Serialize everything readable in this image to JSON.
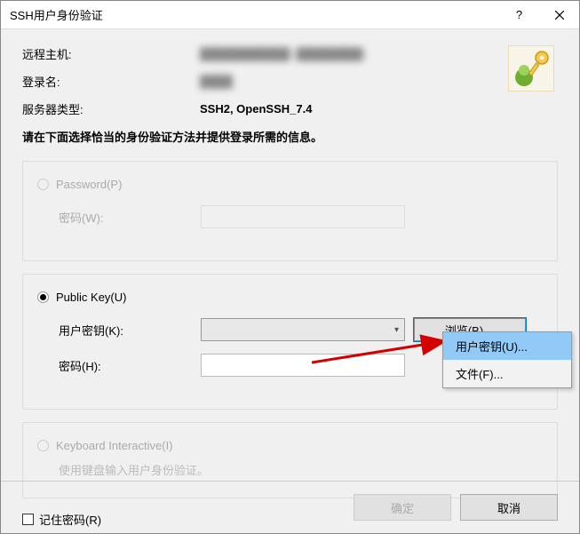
{
  "titlebar": {
    "title": "SSH用户身份验证"
  },
  "info": {
    "host_label": "远程主机:",
    "host_value": "███████████ (████████)",
    "login_label": "登录名:",
    "login_value": "████",
    "server_type_label": "服务器类型:",
    "server_type_value": "SSH2, OpenSSH_7.4"
  },
  "instruction": "请在下面选择恰当的身份验证方法并提供登录所需的信息。",
  "password_group": {
    "radio_label": "Password(P)",
    "pw_label": "密码(W):"
  },
  "pubkey_group": {
    "radio_label": "Public Key(U)",
    "key_label": "用户密钥(K):",
    "pw_label": "密码(H):",
    "browse_label": "浏览(B)…"
  },
  "kbd_group": {
    "radio_label": "Keyboard Interactive(I)",
    "note": "使用键盘输入用户身份验证。"
  },
  "remember_label": "记住密码(R)",
  "footer": {
    "ok": "确定",
    "cancel": "取消"
  },
  "popup": {
    "user_key": "用户密钥(U)...",
    "file": "文件(F)..."
  }
}
